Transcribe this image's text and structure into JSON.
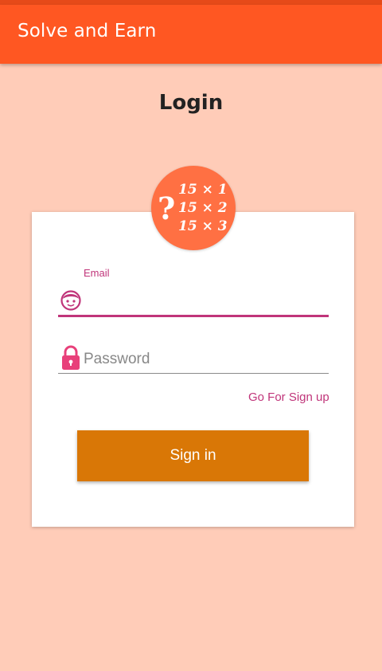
{
  "app_bar": {
    "title": "Solve and Earn",
    "color": "#FF5722"
  },
  "page": {
    "title": "Login",
    "background": "#FFCCB8"
  },
  "logo": {
    "question_mark": "?",
    "lines": [
      "15 × 1",
      "15 × 2",
      "15 × 3"
    ],
    "color": "#FF7043"
  },
  "form": {
    "email": {
      "label": "Email",
      "value": "",
      "icon": "face-icon"
    },
    "password": {
      "placeholder": "Password",
      "value": "",
      "icon": "lock-icon"
    },
    "signup_link": "Go For Sign up",
    "sign_in_label": "Sign in",
    "accent_color": "#C0357A",
    "button_color": "#D97706"
  }
}
